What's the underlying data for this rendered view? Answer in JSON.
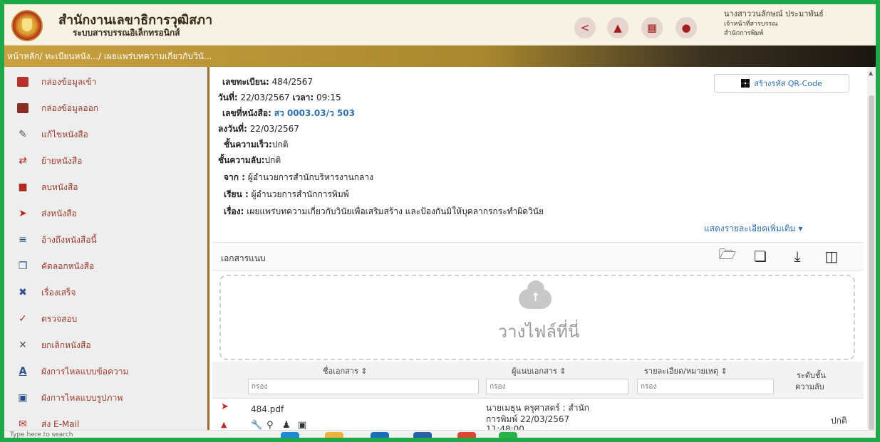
{
  "header": {
    "org_title": "สำนักงานเลขาธิการวุฒิสภา",
    "system_name": "ระบบสารบรรณอิเล็กทรอนิกส์",
    "user_name": "นางสาววนลักษณ์ ประมาพันธ์",
    "user_role": "เจ้าหน้าที่สารบรรณ",
    "user_dept": "สำนักการพิมพ์",
    "icons": [
      "share-icon",
      "bell-icon",
      "apps-icon",
      "user-icon"
    ]
  },
  "breadcrumb": "หน้าหลัก/ ทะเบียนหนัง.../ เผยแพร่บทความเกี่ยวกับวินั...",
  "sidebar": {
    "items": [
      {
        "label": "กล่องข้อมูลเข้า",
        "icon": "inbox-icon"
      },
      {
        "label": "กล่องข้อมูลออก",
        "icon": "outbox-icon"
      },
      {
        "label": "แก้ไขหนังสือ",
        "icon": "pencil-icon"
      },
      {
        "label": "ย้ายหนังสือ",
        "icon": "move-icon"
      },
      {
        "label": "ลบหนังสือ",
        "icon": "trash-icon"
      },
      {
        "label": "ส่งหนังสือ",
        "icon": "send-icon"
      },
      {
        "label": "อ้างถึงหนังสือนี้",
        "icon": "reference-icon"
      },
      {
        "label": "คัดลอกหนังสือ",
        "icon": "copy-icon"
      },
      {
        "label": "เรื่องเสร็จ",
        "icon": "done-icon"
      },
      {
        "label": "ตรวจสอบ",
        "icon": "check-icon"
      },
      {
        "label": "ยกเลิกหนังสือ",
        "icon": "cancel-icon"
      },
      {
        "label": "ผังการไหลแบบข้อความ",
        "icon": "text-flow-icon"
      },
      {
        "label": "ผังการไหลแบบรูปภาพ",
        "icon": "image-flow-icon"
      },
      {
        "label": "ส่ง E-Mail",
        "icon": "mail-icon"
      }
    ]
  },
  "document": {
    "reg_label": "เลขทะเบียน:",
    "reg_value": "484/2567",
    "date_label": "วันที่:",
    "date_value": "22/03/2567",
    "time_label": "เวลา:",
    "time_value": "09:15",
    "doc_no_label": "เลขที่หนังสือ:",
    "doc_no_value": "สว 0003.03/ว 503",
    "signed_label": "ลงวันที่:",
    "signed_value": "22/03/2567",
    "speed_label": "ชั้นความเร็ว:",
    "speed_value": "ปกติ",
    "secret_label": "ชั้นความลับ:",
    "secret_value": "ปกติ",
    "from_label": "จาก :",
    "from_value": "ผู้อำนวยการสำนักบริหารงานกลาง",
    "to_label": "เรียน :",
    "to_value": "ผู้อำนวยการสำนักการพิมพ์",
    "subject_label": "เรื่อง:",
    "subject_value": "เผยแพร่บทความเกี่ยวกับวินัยเพื่อเสริมสร้าง และป้องกันมิให้บุคลากรกระทำผิดวินัย",
    "qr_button": "สร้างรหัส QR-Code",
    "more_link": "แสดงรายละเอียดเพิ่มเติม ▾"
  },
  "attachments": {
    "title": "เอกสารแนบ",
    "dropzone_text": "วางไฟล์ที่นี่",
    "columns": [
      {
        "label": "ชื่อเอกสาร ⇕",
        "filter_placeholder": "กรอง"
      },
      {
        "label": "ผู้แนบเอกสาร ⇕",
        "filter_placeholder": "กรอง"
      },
      {
        "label": "รายละเอียด/หมายเหตุ ⇕",
        "filter_placeholder": "กรอง"
      },
      {
        "label": "ระดับชั้น",
        "label2": "ความลับ"
      }
    ],
    "rows": [
      {
        "name": "484.pdf",
        "attacher_line1": "นายเมธุน ครุศาสตร์ : สำนัก",
        "attacher_line2": "การพิมพ์ 22/03/2567",
        "attacher_line3": "11:48:00",
        "note": "",
        "secret": "ปกติ"
      }
    ]
  },
  "taskbar": {
    "search_placeholder": "Type here to search"
  }
}
